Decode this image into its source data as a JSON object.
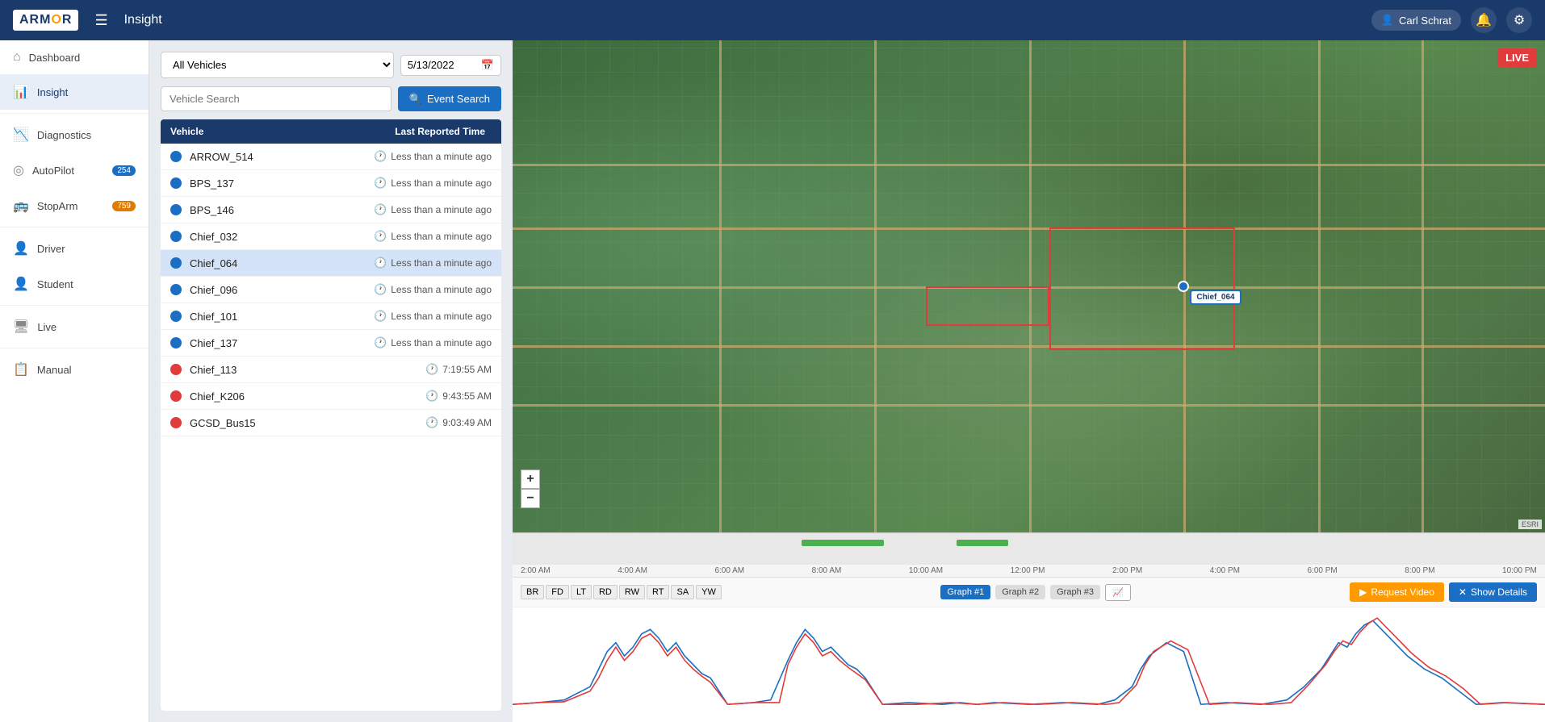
{
  "app": {
    "name": "ARMOR",
    "logo_highlight": "R",
    "page_title": "Insight"
  },
  "navbar": {
    "hamburger_label": "☰",
    "title": "Insight",
    "user_name": "Carl Schrat",
    "user_icon": "👤",
    "bell_icon": "🔔",
    "gear_icon": "⚙"
  },
  "sidebar": {
    "items": [
      {
        "id": "dashboard",
        "label": "Dashboard",
        "icon": "⌂",
        "badge": null
      },
      {
        "id": "insight",
        "label": "Insight",
        "icon": "📊",
        "badge": null,
        "active": true
      },
      {
        "id": "diagnostics",
        "label": "Diagnostics",
        "icon": "📉",
        "badge": null
      },
      {
        "id": "autopilot",
        "label": "AutoPilot",
        "icon": "◎",
        "badge": "254"
      },
      {
        "id": "stoparm",
        "label": "StopArm",
        "icon": "🚌",
        "badge": "759"
      },
      {
        "id": "driver",
        "label": "Driver",
        "icon": "👤",
        "badge": null
      },
      {
        "id": "student",
        "label": "Student",
        "icon": "👤",
        "badge": null
      },
      {
        "id": "live",
        "label": "Live",
        "icon": "🖥",
        "badge": null
      },
      {
        "id": "manual",
        "label": "Manual",
        "icon": "📋",
        "badge": null
      }
    ]
  },
  "filters": {
    "vehicle_dropdown_label": "All Vehicles",
    "date_value": "5/13/2022",
    "vehicle_search_placeholder": "Vehicle Search",
    "event_search_label": "Event Search"
  },
  "vehicle_table": {
    "col_vehicle": "Vehicle",
    "col_time": "Last Reported Time",
    "vehicles": [
      {
        "name": "ARROW_514",
        "time": "Less than a minute ago",
        "dot": "blue",
        "selected": false
      },
      {
        "name": "BPS_137",
        "time": "Less than a minute ago",
        "dot": "blue",
        "selected": false
      },
      {
        "name": "BPS_146",
        "time": "Less than a minute ago",
        "dot": "blue",
        "selected": false
      },
      {
        "name": "Chief_032",
        "time": "Less than a minute ago",
        "dot": "blue",
        "selected": false
      },
      {
        "name": "Chief_064",
        "time": "Less than a minute ago",
        "dot": "blue",
        "selected": true
      },
      {
        "name": "Chief_096",
        "time": "Less than a minute ago",
        "dot": "blue",
        "selected": false
      },
      {
        "name": "Chief_101",
        "time": "Less than a minute ago",
        "dot": "blue",
        "selected": false
      },
      {
        "name": "Chief_137",
        "time": "Less than a minute ago",
        "dot": "blue",
        "selected": false
      },
      {
        "name": "Chief_113",
        "time": "7:19:55 AM",
        "dot": "red",
        "selected": false
      },
      {
        "name": "Chief_K206",
        "time": "9:43:55 AM",
        "dot": "red",
        "selected": false
      },
      {
        "name": "GCSD_Bus15",
        "time": "9:03:49 AM",
        "dot": "red",
        "selected": false
      }
    ]
  },
  "map": {
    "live_badge": "LIVE",
    "zoom_in": "+",
    "zoom_out": "−",
    "vehicle_label": "Chief_064",
    "esri_badge": "ESRI"
  },
  "timeline": {
    "labels": [
      "2:00 AM",
      "4:00 AM",
      "6:00 AM",
      "8:00 AM",
      "10:00 AM",
      "12:00 PM",
      "2:00 PM",
      "4:00 PM",
      "6:00 PM",
      "8:00 PM",
      "10:00 PM"
    ]
  },
  "graph": {
    "filter_buttons": [
      "BR",
      "FD",
      "LT",
      "RD",
      "RW",
      "RT",
      "SA",
      "YW"
    ],
    "graph_buttons": [
      "Graph #1",
      "Graph #2",
      "Graph #3"
    ],
    "active_graph": 0,
    "chart_icon": "📈",
    "request_video_label": "▶ Request Video",
    "show_details_label": "✕ Show Details"
  },
  "colors": {
    "primary": "#1a3a6b",
    "accent": "#1a6fc4",
    "live_red": "#e03c3c",
    "dot_blue": "#1a6fc4",
    "dot_red": "#e03c3c",
    "green": "#4caf50",
    "orange": "#f90"
  }
}
